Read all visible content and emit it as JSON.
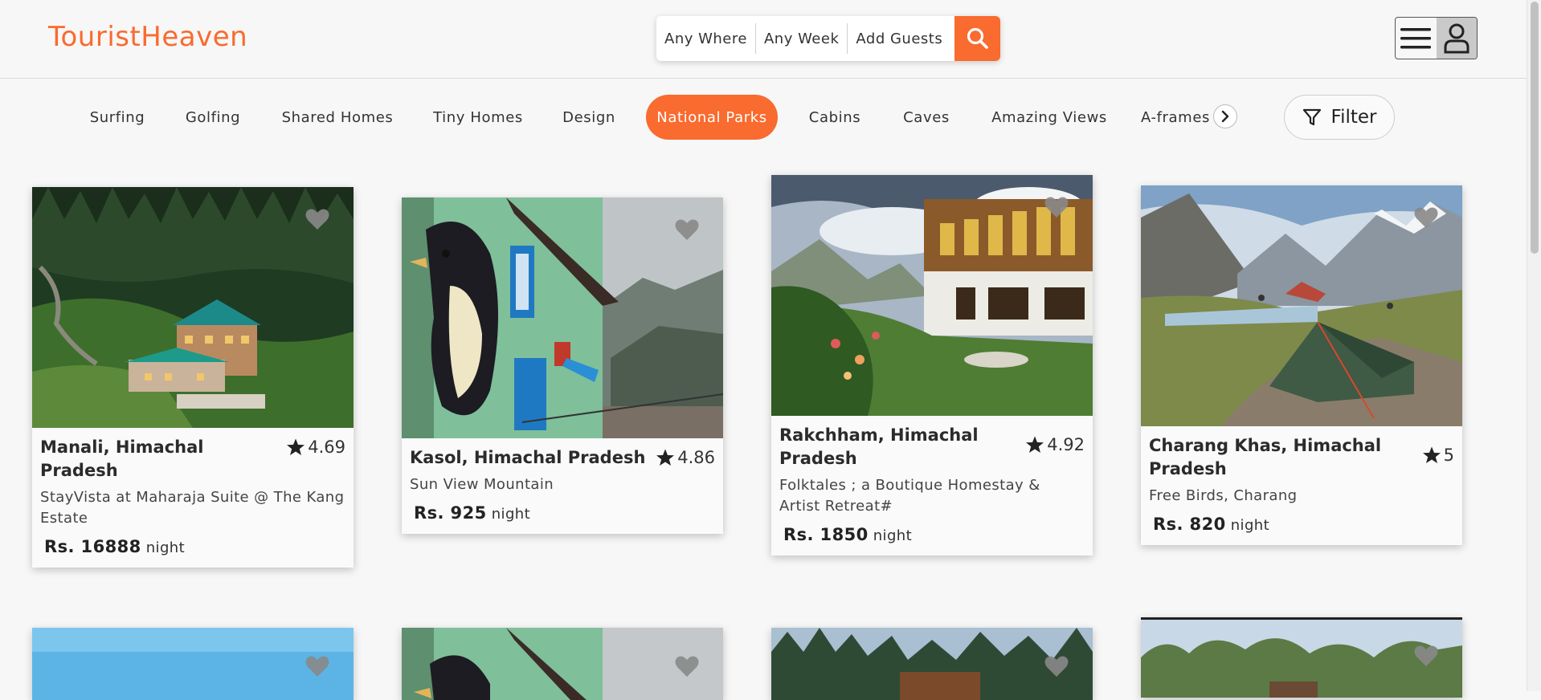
{
  "brand": {
    "name": "TouristHeaven",
    "accent": "#f96b2e"
  },
  "search": {
    "where": "Any Where",
    "week": "Any Week",
    "guests": "Add Guests",
    "button_icon": "search-icon"
  },
  "user_menu": {
    "menu_icon": "hamburger-icon",
    "user_icon": "user-icon"
  },
  "categories": [
    {
      "label": "Surfing",
      "active": false
    },
    {
      "label": "Golfing",
      "active": false
    },
    {
      "label": "Shared Homes",
      "active": false
    },
    {
      "label": "Tiny Homes",
      "active": false
    },
    {
      "label": "Design",
      "active": false
    },
    {
      "label": "National Parks",
      "active": true
    },
    {
      "label": "Cabins",
      "active": false
    },
    {
      "label": "Caves",
      "active": false
    },
    {
      "label": "Amazing Views",
      "active": false
    },
    {
      "label": "A-frames",
      "active": false
    }
  ],
  "category_next_icon": "chevron-right-icon",
  "filter": {
    "label": "Filter",
    "icon": "filter-icon"
  },
  "listings": [
    {
      "place": "Manali, Himachal Pradesh",
      "rating": "4.69",
      "desc": "StayVista at Maharaja Suite @ The Kang Estate",
      "price": "Rs. 16888",
      "unit": "night"
    },
    {
      "place": "Kasol, Himachal Pradesh",
      "rating": "4.86",
      "desc": "Sun View Mountain",
      "price": "Rs. 925",
      "unit": "night"
    },
    {
      "place": "Rakchham, Himachal Pradesh",
      "rating": "4.92",
      "desc": "Folktales ; a Boutique Homestay & Artist Retreat#",
      "price": "Rs. 1850",
      "unit": "night"
    },
    {
      "place": "Charang Khas, Himachal Pradesh",
      "rating": "5",
      "desc": "Free Birds, Charang",
      "price": "Rs. 820",
      "unit": "night"
    }
  ]
}
